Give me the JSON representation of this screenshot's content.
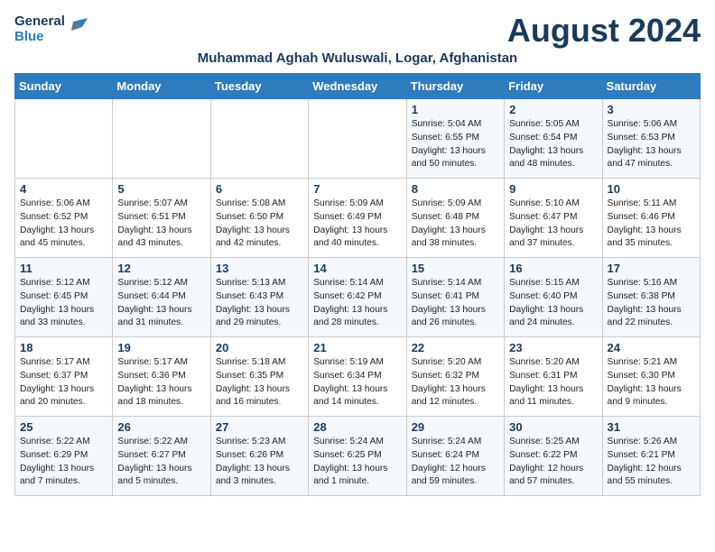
{
  "header": {
    "logo_general": "General",
    "logo_blue": "Blue",
    "month_title": "August 2024",
    "subtitle": "Muhammad Aghah Wuluswali, Logar, Afghanistan"
  },
  "weekdays": [
    "Sunday",
    "Monday",
    "Tuesday",
    "Wednesday",
    "Thursday",
    "Friday",
    "Saturday"
  ],
  "weeks": [
    [
      {
        "day": "",
        "text": ""
      },
      {
        "day": "",
        "text": ""
      },
      {
        "day": "",
        "text": ""
      },
      {
        "day": "",
        "text": ""
      },
      {
        "day": "1",
        "text": "Sunrise: 5:04 AM\nSunset: 6:55 PM\nDaylight: 13 hours\nand 50 minutes."
      },
      {
        "day": "2",
        "text": "Sunrise: 5:05 AM\nSunset: 6:54 PM\nDaylight: 13 hours\nand 48 minutes."
      },
      {
        "day": "3",
        "text": "Sunrise: 5:06 AM\nSunset: 6:53 PM\nDaylight: 13 hours\nand 47 minutes."
      }
    ],
    [
      {
        "day": "4",
        "text": "Sunrise: 5:06 AM\nSunset: 6:52 PM\nDaylight: 13 hours\nand 45 minutes."
      },
      {
        "day": "5",
        "text": "Sunrise: 5:07 AM\nSunset: 6:51 PM\nDaylight: 13 hours\nand 43 minutes."
      },
      {
        "day": "6",
        "text": "Sunrise: 5:08 AM\nSunset: 6:50 PM\nDaylight: 13 hours\nand 42 minutes."
      },
      {
        "day": "7",
        "text": "Sunrise: 5:09 AM\nSunset: 6:49 PM\nDaylight: 13 hours\nand 40 minutes."
      },
      {
        "day": "8",
        "text": "Sunrise: 5:09 AM\nSunset: 6:48 PM\nDaylight: 13 hours\nand 38 minutes."
      },
      {
        "day": "9",
        "text": "Sunrise: 5:10 AM\nSunset: 6:47 PM\nDaylight: 13 hours\nand 37 minutes."
      },
      {
        "day": "10",
        "text": "Sunrise: 5:11 AM\nSunset: 6:46 PM\nDaylight: 13 hours\nand 35 minutes."
      }
    ],
    [
      {
        "day": "11",
        "text": "Sunrise: 5:12 AM\nSunset: 6:45 PM\nDaylight: 13 hours\nand 33 minutes."
      },
      {
        "day": "12",
        "text": "Sunrise: 5:12 AM\nSunset: 6:44 PM\nDaylight: 13 hours\nand 31 minutes."
      },
      {
        "day": "13",
        "text": "Sunrise: 5:13 AM\nSunset: 6:43 PM\nDaylight: 13 hours\nand 29 minutes."
      },
      {
        "day": "14",
        "text": "Sunrise: 5:14 AM\nSunset: 6:42 PM\nDaylight: 13 hours\nand 28 minutes."
      },
      {
        "day": "15",
        "text": "Sunrise: 5:14 AM\nSunset: 6:41 PM\nDaylight: 13 hours\nand 26 minutes."
      },
      {
        "day": "16",
        "text": "Sunrise: 5:15 AM\nSunset: 6:40 PM\nDaylight: 13 hours\nand 24 minutes."
      },
      {
        "day": "17",
        "text": "Sunrise: 5:16 AM\nSunset: 6:38 PM\nDaylight: 13 hours\nand 22 minutes."
      }
    ],
    [
      {
        "day": "18",
        "text": "Sunrise: 5:17 AM\nSunset: 6:37 PM\nDaylight: 13 hours\nand 20 minutes."
      },
      {
        "day": "19",
        "text": "Sunrise: 5:17 AM\nSunset: 6:36 PM\nDaylight: 13 hours\nand 18 minutes."
      },
      {
        "day": "20",
        "text": "Sunrise: 5:18 AM\nSunset: 6:35 PM\nDaylight: 13 hours\nand 16 minutes."
      },
      {
        "day": "21",
        "text": "Sunrise: 5:19 AM\nSunset: 6:34 PM\nDaylight: 13 hours\nand 14 minutes."
      },
      {
        "day": "22",
        "text": "Sunrise: 5:20 AM\nSunset: 6:32 PM\nDaylight: 13 hours\nand 12 minutes."
      },
      {
        "day": "23",
        "text": "Sunrise: 5:20 AM\nSunset: 6:31 PM\nDaylight: 13 hours\nand 11 minutes."
      },
      {
        "day": "24",
        "text": "Sunrise: 5:21 AM\nSunset: 6:30 PM\nDaylight: 13 hours\nand 9 minutes."
      }
    ],
    [
      {
        "day": "25",
        "text": "Sunrise: 5:22 AM\nSunset: 6:29 PM\nDaylight: 13 hours\nand 7 minutes."
      },
      {
        "day": "26",
        "text": "Sunrise: 5:22 AM\nSunset: 6:27 PM\nDaylight: 13 hours\nand 5 minutes."
      },
      {
        "day": "27",
        "text": "Sunrise: 5:23 AM\nSunset: 6:26 PM\nDaylight: 13 hours\nand 3 minutes."
      },
      {
        "day": "28",
        "text": "Sunrise: 5:24 AM\nSunset: 6:25 PM\nDaylight: 13 hours\nand 1 minute."
      },
      {
        "day": "29",
        "text": "Sunrise: 5:24 AM\nSunset: 6:24 PM\nDaylight: 12 hours\nand 59 minutes."
      },
      {
        "day": "30",
        "text": "Sunrise: 5:25 AM\nSunset: 6:22 PM\nDaylight: 12 hours\nand 57 minutes."
      },
      {
        "day": "31",
        "text": "Sunrise: 5:26 AM\nSunset: 6:21 PM\nDaylight: 12 hours\nand 55 minutes."
      }
    ]
  ]
}
